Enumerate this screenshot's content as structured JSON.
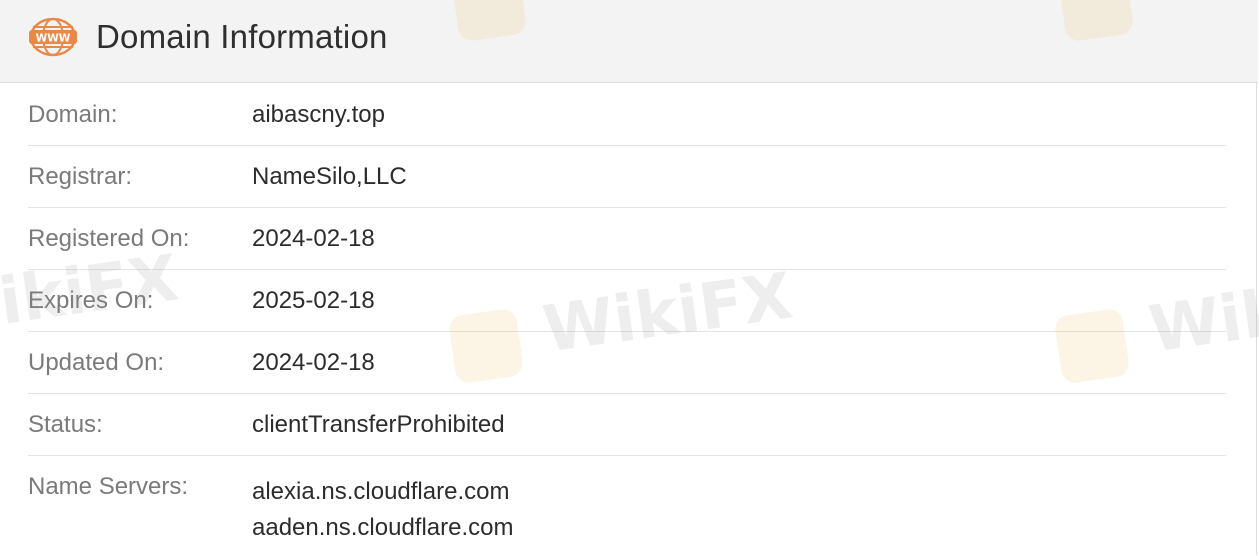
{
  "header": {
    "icon": "www-icon",
    "title": "Domain Information"
  },
  "fields": [
    {
      "label": "Domain:",
      "value": "aibascny.top"
    },
    {
      "label": "Registrar:",
      "value": "NameSilo,LLC"
    },
    {
      "label": "Registered On:",
      "value": "2024-02-18"
    },
    {
      "label": "Expires On:",
      "value": "2025-02-18"
    },
    {
      "label": "Updated On:",
      "value": "2024-02-18"
    },
    {
      "label": "Status:",
      "value": "clientTransferProhibited"
    }
  ],
  "name_servers": {
    "label": "Name Servers:",
    "values": [
      "alexia.ns.cloudflare.com",
      "aaden.ns.cloudflare.com"
    ]
  },
  "watermark": {
    "text": "WikiFX",
    "color": "#f0c060"
  },
  "colors": {
    "accent": "#e8894a",
    "header_bg": "#f3f3f3",
    "label": "#7a7a7a",
    "value": "#2c2c2c"
  }
}
